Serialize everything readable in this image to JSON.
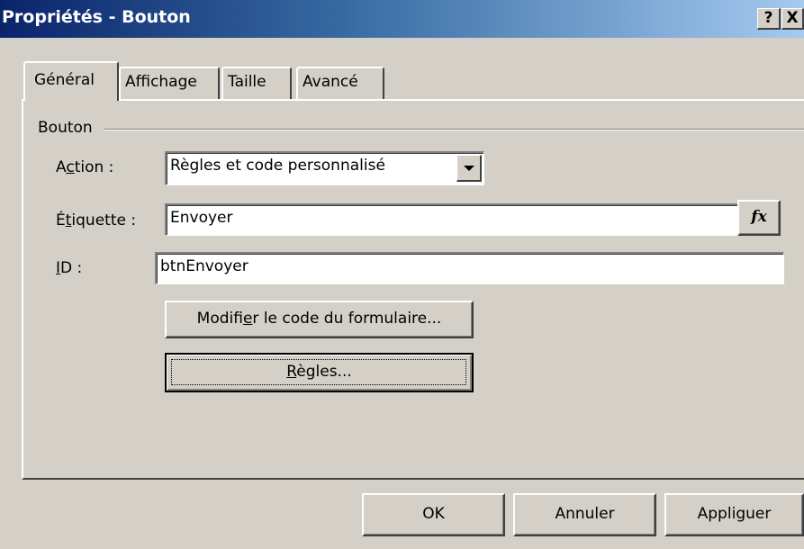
{
  "window": {
    "title": "Propriétés - Bouton",
    "help_button": "?",
    "close_button": "X"
  },
  "tabs": [
    {
      "label": "Général",
      "active": true
    },
    {
      "label": "Affichage",
      "active": false
    },
    {
      "label": "Taille",
      "active": false
    },
    {
      "label": "Avancé",
      "active": false
    }
  ],
  "group": {
    "title": "Bouton"
  },
  "fields": {
    "action": {
      "label_pre": "A",
      "label_mnemonic": "c",
      "label_post": "tion :",
      "value": "Règles et code personnalisé"
    },
    "etiquette": {
      "label_pre": "É",
      "label_mnemonic": "t",
      "label_post": "iquette :",
      "value": "Envoyer",
      "fx_label": "fx"
    },
    "id": {
      "label_mnemonic": "I",
      "label_post": "D :",
      "value": "btnEnvoyer"
    }
  },
  "buttons": {
    "modify_code": {
      "label_pre": "Modifi",
      "label_mnemonic": "e",
      "label_post": "r le code du formulaire..."
    },
    "rules": {
      "label_mnemonic": "R",
      "label_post": "ègles..."
    },
    "ok": "OK",
    "cancel": "Annuler",
    "apply": {
      "label_pre": "Appli",
      "label_mnemonic": "g",
      "label_post": "uer"
    }
  }
}
